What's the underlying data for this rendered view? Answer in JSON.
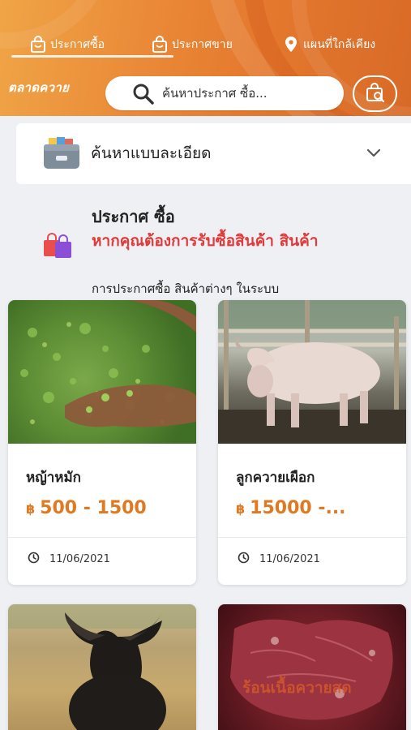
{
  "header": {
    "tabs": [
      {
        "label": "ประกาศซื้อ",
        "icon": "shopping-bag-icon",
        "active": true
      },
      {
        "label": "ประกาศขาย",
        "icon": "shopping-bag-icon",
        "active": false
      },
      {
        "label": "แผนที่ใกล้เคียง",
        "icon": "map-pin-icon",
        "active": false
      }
    ],
    "brand": "ตลาดควาย",
    "search_placeholder": "ค้นหาประกาศ ซื้อ...",
    "colors": {
      "primary": "#e57a2e",
      "accent_price": "#e07a22",
      "alert_red": "#e03a3a"
    }
  },
  "filter": {
    "label": "ค้นหาแบบละเอียด",
    "icon": "filing-box-icon"
  },
  "announcement": {
    "title": "ประกาศ ซื้อ",
    "highlight": "หากคุณต้องการรับซื้อสินค้า สินค้า",
    "description": "การประกาศซื้อ สินค้าต่างๆ ในระบบ"
  },
  "products": [
    {
      "name": "หญ้าหมัก",
      "price": "500 - 1500",
      "currency": "฿",
      "date": "11/06/2021",
      "image": "silage-grass-photo"
    },
    {
      "name": "ลูกควายเผือก",
      "price": "15000 -...",
      "currency": "฿",
      "date": "11/06/2021",
      "image": "albino-buffalo-photo"
    },
    {
      "name": "",
      "price": "",
      "currency": "",
      "date": "",
      "image": "black-buffalo-photo"
    },
    {
      "name": "",
      "price": "",
      "currency": "",
      "date": "",
      "image": "raw-meat-photo",
      "overlay": "ร้อนเนื้อควายสด"
    }
  ]
}
